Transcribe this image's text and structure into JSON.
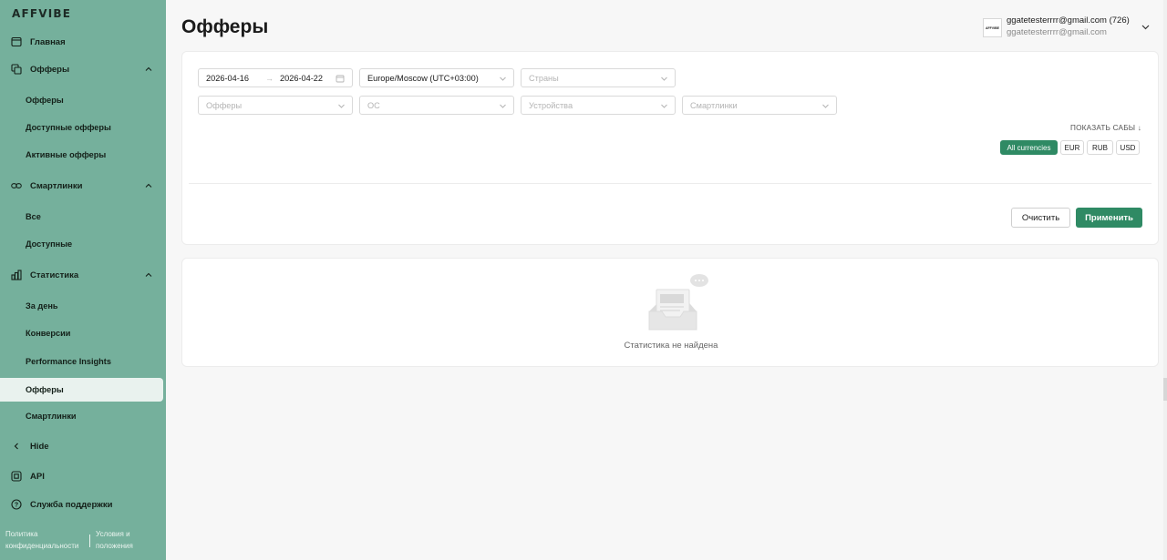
{
  "sidebar": {
    "logo": "AFFVIBE",
    "home": "Главная",
    "offers_section": "Офферы",
    "offers_items": [
      "Офферы",
      "Доступные офферы",
      "Активные офферы"
    ],
    "smartlinks_section": "Смартлинки",
    "smartlinks_items": [
      "Все",
      "Доступные"
    ],
    "stats_section": "Статистика",
    "stats_items": [
      "За день",
      "Конверсии",
      "Performance Insights",
      "Офферы",
      "Смартлинки"
    ],
    "hide": "Hide",
    "api": "API",
    "support": "Служба поддержки",
    "footer_privacy": "Политика конфиденциальности",
    "footer_terms": "Условия и положения"
  },
  "header": {
    "title": "Офферы",
    "user_primary": "ggatetesterrrr@gmail.com (726)",
    "user_secondary": "ggatetesterrrr@gmail.com",
    "avatar_text": "AFFVIBE"
  },
  "filters": {
    "date_from": "2026-04-16",
    "date_to": "2026-04-22",
    "date_arrow": "→",
    "timezone": "Europe/Moscow (UTC+03:00)",
    "countries_placeholder": "Страны",
    "offers_placeholder": "Офферы",
    "os_placeholder": "ОС",
    "devices_placeholder": "Устройства",
    "smartlinks_placeholder": "Смартлинки",
    "show_subs": "ПОКАЗАТЬ САБЫ ↓",
    "currencies": [
      "All currencies",
      "EUR",
      "RUB",
      "USD"
    ],
    "selected_currency": "All currencies",
    "clear_label": "Очистить",
    "apply_label": "Применить"
  },
  "empty": {
    "message": "Статистика не найдена"
  },
  "colors": {
    "sidebar_bg": "#75b09c",
    "accent": "#2f8a64",
    "active_item_bg": "#e9f2ee"
  }
}
